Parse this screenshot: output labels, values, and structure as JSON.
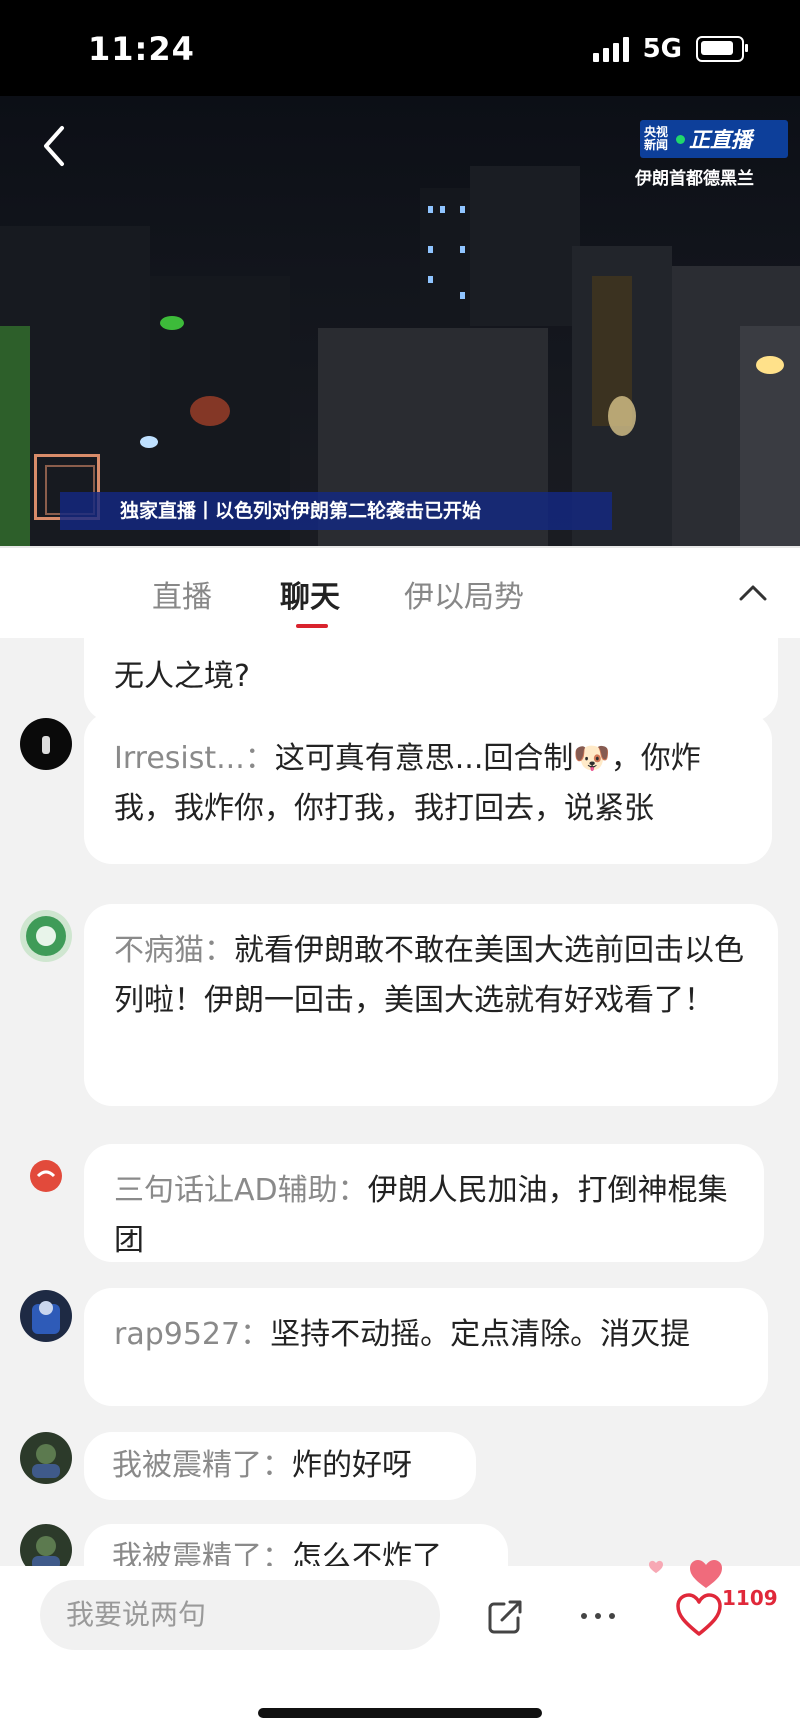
{
  "status_bar": {
    "time": "11:24",
    "network": "5G"
  },
  "video": {
    "logo_line1": "央视",
    "logo_line2": "新闻",
    "logo_live": "正直播",
    "location": "伊朗首都德黑兰",
    "banner": "独家直播丨以色列对伊朗第二轮袭击已开始"
  },
  "tabs": [
    {
      "label": "直播",
      "active": false
    },
    {
      "label": "聊天",
      "active": true
    },
    {
      "label": "伊以局势",
      "active": false
    }
  ],
  "messages": [
    {
      "nick": "",
      "text": "无人之境?"
    },
    {
      "nick": "Irresist...：",
      "text": "这可真有意思...回合制🐶，你炸我，我炸你，你打我，我打回去，说紧张"
    },
    {
      "nick": "不病猫：",
      "text": "就看伊朗敢不敢在美国大选前回击以色列啦！伊朗一回击，美国大选就有好戏看了！"
    },
    {
      "nick": "三句话让AD辅助：",
      "text": "伊朗人民加油，打倒神棍集团"
    },
    {
      "nick": "rap9527：",
      "text": "坚持不动摇。定点清除。消灭提"
    },
    {
      "nick": "我被震精了：",
      "text": "炸的好呀"
    },
    {
      "nick": "我被震精了：",
      "text": "怎么不炸了"
    }
  ],
  "bottom_bar": {
    "input_placeholder": "我要说两句",
    "like_count": "1109"
  },
  "colors": {
    "accent": "#d9232d",
    "banner": "#14288a",
    "cctv": "#0d3f9a"
  }
}
